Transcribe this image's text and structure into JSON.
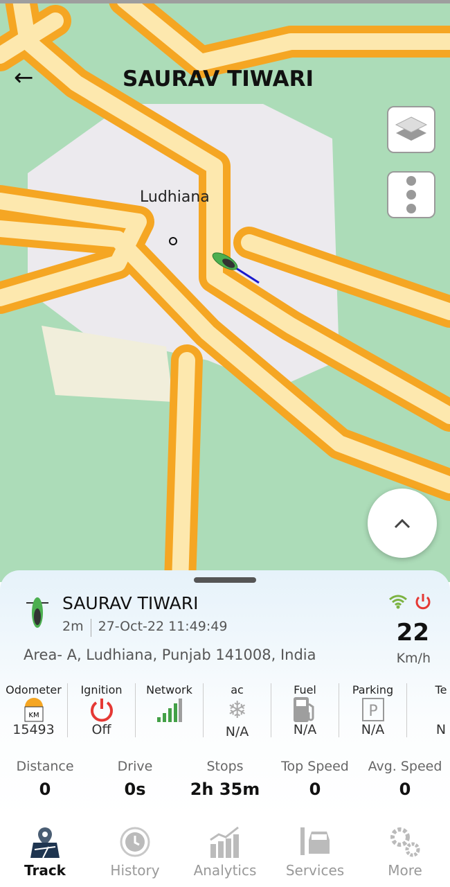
{
  "header": {
    "title": "SAURAV TIWARI",
    "back_icon": "arrow-left-icon"
  },
  "map": {
    "city_label": "Ludhiana",
    "layers_icon": "layers-icon",
    "more_icon": "more-vertical-icon",
    "expand_icon": "chevron-up-icon"
  },
  "vehicle": {
    "name": "SAURAV TIWARI",
    "age": "2m",
    "timestamp": "27-Oct-22 11:49:49",
    "address": "Area- A, Ludhiana, Punjab 141008, India",
    "speed": "22",
    "speed_unit": "Km/h",
    "status_colors": {
      "gps": "#7cb342",
      "power": "#e53935"
    }
  },
  "stats": [
    {
      "label": "Odometer",
      "value": "15493",
      "icon": "odometer-km-icon",
      "icon_text": "KM"
    },
    {
      "label": "Ignition",
      "value": "Off",
      "icon": "power-icon"
    },
    {
      "label": "Network",
      "value": "",
      "icon": "signal-bars-icon"
    },
    {
      "label": "ac",
      "value": "N/A",
      "icon": "snowflake-icon"
    },
    {
      "label": "Fuel",
      "value": "N/A",
      "icon": "fuel-pump-icon"
    },
    {
      "label": "Parking",
      "value": "N/A",
      "icon": "parking-icon",
      "icon_text": "P"
    },
    {
      "label": "Te",
      "value": "N",
      "icon": "temperature-icon"
    }
  ],
  "trip": [
    {
      "label": "Distance",
      "value": "0"
    },
    {
      "label": "Drive",
      "value": "0s"
    },
    {
      "label": "Stops",
      "value": "2h 35m"
    },
    {
      "label": "Top Speed",
      "value": "0"
    },
    {
      "label": "Avg. Speed",
      "value": "0"
    }
  ],
  "nav": [
    {
      "label": "Track",
      "icon": "map-pin-icon",
      "active": true
    },
    {
      "label": "History",
      "icon": "history-clock-icon"
    },
    {
      "label": "Analytics",
      "icon": "analytics-chart-icon"
    },
    {
      "label": "Services",
      "icon": "car-service-icon"
    },
    {
      "label": "More",
      "icon": "gears-icon"
    }
  ]
}
